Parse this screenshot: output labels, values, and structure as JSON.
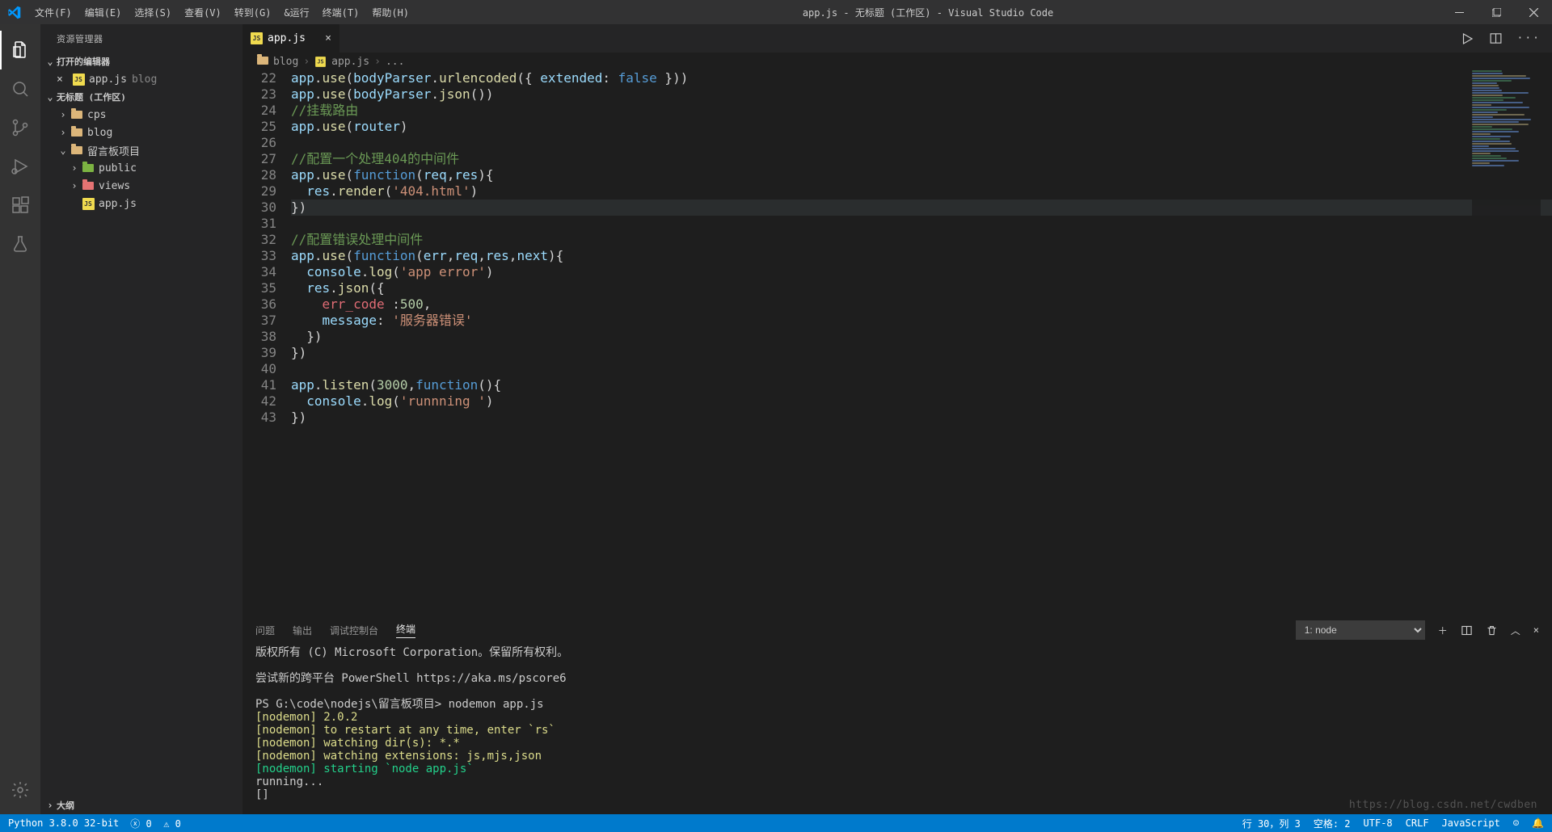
{
  "menu": {
    "file": "文件(F)",
    "edit": "编辑(E)",
    "select": "选择(S)",
    "view": "查看(V)",
    "goto": "转到(G)",
    "run": "&运行",
    "terminal": "终端(T)",
    "help": "帮助(H)"
  },
  "window_title": "app.js - 无标题 (工作区) - Visual Studio Code",
  "sidebar": {
    "title": "资源管理器",
    "open_editors": "打开的编辑器",
    "open_item": {
      "name": "app.js",
      "dir": "blog"
    },
    "workspace": "无标题 (工作区)",
    "tree": [
      {
        "type": "folder",
        "name": "cps",
        "icon": "folder-y",
        "indent": 1,
        "open": false
      },
      {
        "type": "folder",
        "name": "blog",
        "icon": "folder-y",
        "indent": 1,
        "open": false
      },
      {
        "type": "folder",
        "name": "留言板项目",
        "icon": "folder-y",
        "indent": 1,
        "open": true
      },
      {
        "type": "folder",
        "name": "public",
        "icon": "folder-g",
        "indent": 2,
        "open": false
      },
      {
        "type": "folder",
        "name": "views",
        "icon": "folder-r",
        "indent": 2,
        "open": false
      },
      {
        "type": "file",
        "name": "app.js",
        "icon": "js",
        "indent": 2
      }
    ],
    "outline": "大纲"
  },
  "tab": {
    "name": "app.js"
  },
  "breadcrumb": {
    "folder": "blog",
    "file": "app.js",
    "more": "..."
  },
  "code": {
    "start": 22,
    "lines": [
      [
        [
          "v",
          "app"
        ],
        [
          "p",
          "."
        ],
        [
          "fn",
          "use"
        ],
        [
          "p",
          "("
        ],
        [
          "v",
          "bodyParser"
        ],
        [
          "p",
          "."
        ],
        [
          "fn",
          "urlencoded"
        ],
        [
          "p",
          "({ "
        ],
        [
          "v",
          "extended"
        ],
        [
          "p",
          ": "
        ],
        [
          "k",
          "false"
        ],
        [
          "p",
          " }))"
        ]
      ],
      [
        [
          "v",
          "app"
        ],
        [
          "p",
          "."
        ],
        [
          "fn",
          "use"
        ],
        [
          "p",
          "("
        ],
        [
          "v",
          "bodyParser"
        ],
        [
          "p",
          "."
        ],
        [
          "fn",
          "json"
        ],
        [
          "p",
          "())"
        ]
      ],
      [
        [
          "cm",
          "//挂载路由"
        ]
      ],
      [
        [
          "v",
          "app"
        ],
        [
          "p",
          "."
        ],
        [
          "fn",
          "use"
        ],
        [
          "p",
          "("
        ],
        [
          "v",
          "router"
        ],
        [
          "p",
          ")"
        ]
      ],
      [
        [
          "p",
          ""
        ]
      ],
      [
        [
          "cm",
          "//配置一个处理404的中间件"
        ]
      ],
      [
        [
          "v",
          "app"
        ],
        [
          "p",
          "."
        ],
        [
          "fn",
          "use"
        ],
        [
          "p",
          "("
        ],
        [
          "k",
          "function"
        ],
        [
          "p",
          "("
        ],
        [
          "v",
          "req"
        ],
        [
          "p",
          ","
        ],
        [
          "v",
          "res"
        ],
        [
          "p",
          "){"
        ]
      ],
      [
        [
          "p",
          "  "
        ],
        [
          "v",
          "res"
        ],
        [
          "p",
          "."
        ],
        [
          "fn",
          "render"
        ],
        [
          "p",
          "("
        ],
        [
          "s",
          "'404.html'"
        ],
        [
          "p",
          ")"
        ]
      ],
      [
        [
          "p",
          "})"
        ]
      ],
      [
        [
          "p",
          ""
        ]
      ],
      [
        [
          "cm",
          "//配置错误处理中间件"
        ]
      ],
      [
        [
          "v",
          "app"
        ],
        [
          "p",
          "."
        ],
        [
          "fn",
          "use"
        ],
        [
          "p",
          "("
        ],
        [
          "k",
          "function"
        ],
        [
          "p",
          "("
        ],
        [
          "v",
          "err"
        ],
        [
          "p",
          ","
        ],
        [
          "v",
          "req"
        ],
        [
          "p",
          ","
        ],
        [
          "v",
          "res"
        ],
        [
          "p",
          ","
        ],
        [
          "v",
          "next"
        ],
        [
          "p",
          "){"
        ]
      ],
      [
        [
          "p",
          "  "
        ],
        [
          "v",
          "console"
        ],
        [
          "p",
          "."
        ],
        [
          "fn",
          "log"
        ],
        [
          "p",
          "("
        ],
        [
          "s",
          "'app error'"
        ],
        [
          "p",
          ")"
        ]
      ],
      [
        [
          "p",
          "  "
        ],
        [
          "v",
          "res"
        ],
        [
          "p",
          "."
        ],
        [
          "fn",
          "json"
        ],
        [
          "p",
          "({"
        ]
      ],
      [
        [
          "p",
          "    "
        ],
        [
          "w",
          "err_code"
        ],
        [
          "p",
          " :"
        ],
        [
          "n",
          "500"
        ],
        [
          "p",
          ","
        ]
      ],
      [
        [
          "p",
          "    "
        ],
        [
          "v",
          "message"
        ],
        [
          "p",
          ": "
        ],
        [
          "s",
          "'服务器错误'"
        ]
      ],
      [
        [
          "p",
          "  })"
        ]
      ],
      [
        [
          "p",
          "})"
        ]
      ],
      [
        [
          "p",
          ""
        ]
      ],
      [
        [
          "v",
          "app"
        ],
        [
          "p",
          "."
        ],
        [
          "fn",
          "listen"
        ],
        [
          "p",
          "("
        ],
        [
          "n",
          "3000"
        ],
        [
          "p",
          ","
        ],
        [
          "k",
          "function"
        ],
        [
          "p",
          "(){"
        ]
      ],
      [
        [
          "p",
          "  "
        ],
        [
          "v",
          "console"
        ],
        [
          "p",
          "."
        ],
        [
          "fn",
          "log"
        ],
        [
          "p",
          "("
        ],
        [
          "s",
          "'runnning '"
        ],
        [
          "p",
          ")"
        ]
      ],
      [
        [
          "p",
          "})"
        ]
      ]
    ],
    "highlight_line": 30
  },
  "panel": {
    "tabs": {
      "problems": "问题",
      "output": "输出",
      "debug": "调试控制台",
      "terminal": "终端"
    },
    "dropdown": "1: node",
    "lines": [
      {
        "cls": "",
        "text": "版权所有 (C) Microsoft Corporation。保留所有权利。"
      },
      {
        "cls": "",
        "text": ""
      },
      {
        "cls": "",
        "text": "尝试新的跨平台 PowerShell https://aka.ms/pscore6"
      },
      {
        "cls": "",
        "text": ""
      },
      {
        "cls": "",
        "text": "PS G:\\code\\nodejs\\留言板项目> nodemon app.js"
      },
      {
        "cls": "y",
        "text": "[nodemon] 2.0.2"
      },
      {
        "cls": "y",
        "text": "[nodemon] to restart at any time, enter `rs`"
      },
      {
        "cls": "y",
        "text": "[nodemon] watching dir(s): *.*"
      },
      {
        "cls": "y",
        "text": "[nodemon] watching extensions: js,mjs,json"
      },
      {
        "cls": "g",
        "text": "[nodemon] starting `node app.js`"
      },
      {
        "cls": "",
        "text": "running..."
      },
      {
        "cls": "",
        "text": "[]"
      }
    ]
  },
  "status": {
    "python": "Python 3.8.0 32-bit",
    "errors": "0",
    "warnings": "0",
    "ln_col": "行 30，列 3",
    "spaces": "空格: 2",
    "enc": "UTF-8",
    "eol": "CRLF",
    "lang": "JavaScript"
  },
  "watermark": "https://blog.csdn.net/cwdben"
}
